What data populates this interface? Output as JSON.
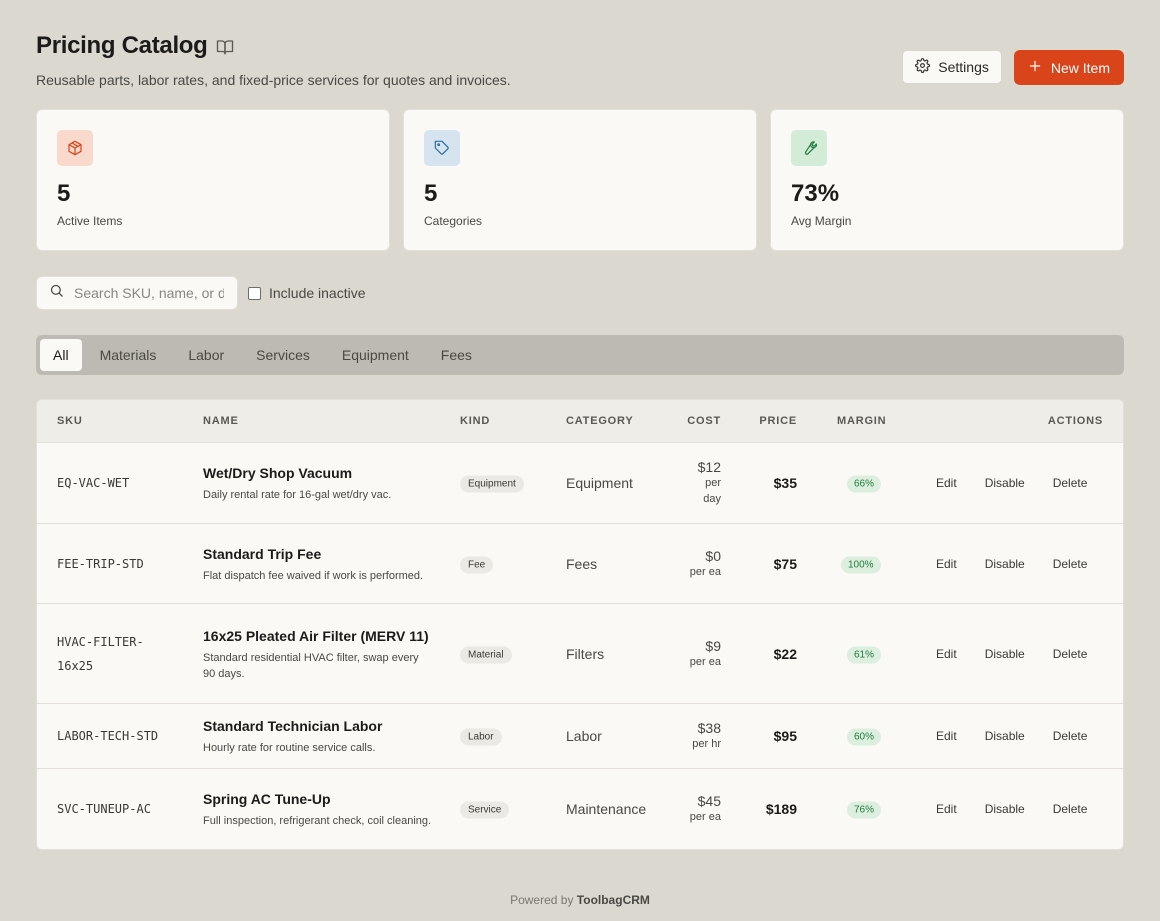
{
  "header": {
    "title": "Pricing Catalog",
    "subtitle": "Reusable parts, labor rates, and fixed-price services for quotes and invoices.",
    "settings_label": "Settings",
    "new_item_label": "New Item"
  },
  "stats": [
    {
      "value": "5",
      "label": "Active Items",
      "icon": "package-icon",
      "color": "#d9441a",
      "bg": "#f8d9cc"
    },
    {
      "value": "5",
      "label": "Categories",
      "icon": "tag-icon",
      "color": "#2d6a9f",
      "bg": "#d5e4ef"
    },
    {
      "value": "73%",
      "label": "Avg Margin",
      "icon": "wrench-icon",
      "color": "#217a3f",
      "bg": "#d3ecd8"
    }
  ],
  "search": {
    "placeholder": "Search SKU, name, or description",
    "include_inactive_label": "Include inactive"
  },
  "tabs": [
    {
      "label": "All",
      "active": true
    },
    {
      "label": "Materials",
      "active": false
    },
    {
      "label": "Labor",
      "active": false
    },
    {
      "label": "Services",
      "active": false
    },
    {
      "label": "Equipment",
      "active": false
    },
    {
      "label": "Fees",
      "active": false
    }
  ],
  "table": {
    "columns": {
      "sku": "SKU",
      "name": "NAME",
      "kind": "KIND",
      "category": "CATEGORY",
      "cost": "COST",
      "price": "PRICE",
      "margin": "MARGIN",
      "actions": "ACTIONS"
    },
    "action_labels": {
      "edit": "Edit",
      "disable": "Disable",
      "delete": "Delete"
    },
    "rows": [
      {
        "sku": "EQ-VAC-WET",
        "name": "Wet/Dry Shop Vacuum",
        "description": "Daily rental rate for 16-gal wet/dry vac.",
        "kind": "Equipment",
        "category": "Equipment",
        "cost": "$12",
        "cost_unit": "per day",
        "price": "$35",
        "margin": "66%"
      },
      {
        "sku": "FEE-TRIP-STD",
        "name": "Standard Trip Fee",
        "description": "Flat dispatch fee waived if work is performed.",
        "kind": "Fee",
        "category": "Fees",
        "cost": "$0",
        "cost_unit": "per ea",
        "price": "$75",
        "margin": "100%"
      },
      {
        "sku": "HVAC-FILTER-16x25",
        "name": "16x25 Pleated Air Filter (MERV 11)",
        "description": "Standard residential HVAC filter, swap every 90 days.",
        "kind": "Material",
        "category": "Filters",
        "cost": "$9",
        "cost_unit": "per ea",
        "price": "$22",
        "margin": "61%"
      },
      {
        "sku": "LABOR-TECH-STD",
        "name": "Standard Technician Labor",
        "description": "Hourly rate for routine service calls.",
        "kind": "Labor",
        "category": "Labor",
        "cost": "$38",
        "cost_unit": "per hr",
        "price": "$95",
        "margin": "60%"
      },
      {
        "sku": "SVC-TUNEUP-AC",
        "name": "Spring AC Tune-Up",
        "description": "Full inspection, refrigerant check, coil cleaning.",
        "kind": "Service",
        "category": "Maintenance",
        "cost": "$45",
        "cost_unit": "per ea",
        "price": "$189",
        "margin": "76%"
      }
    ]
  },
  "footer": {
    "prefix": "Powered by",
    "brand": "ToolbagCRM"
  }
}
